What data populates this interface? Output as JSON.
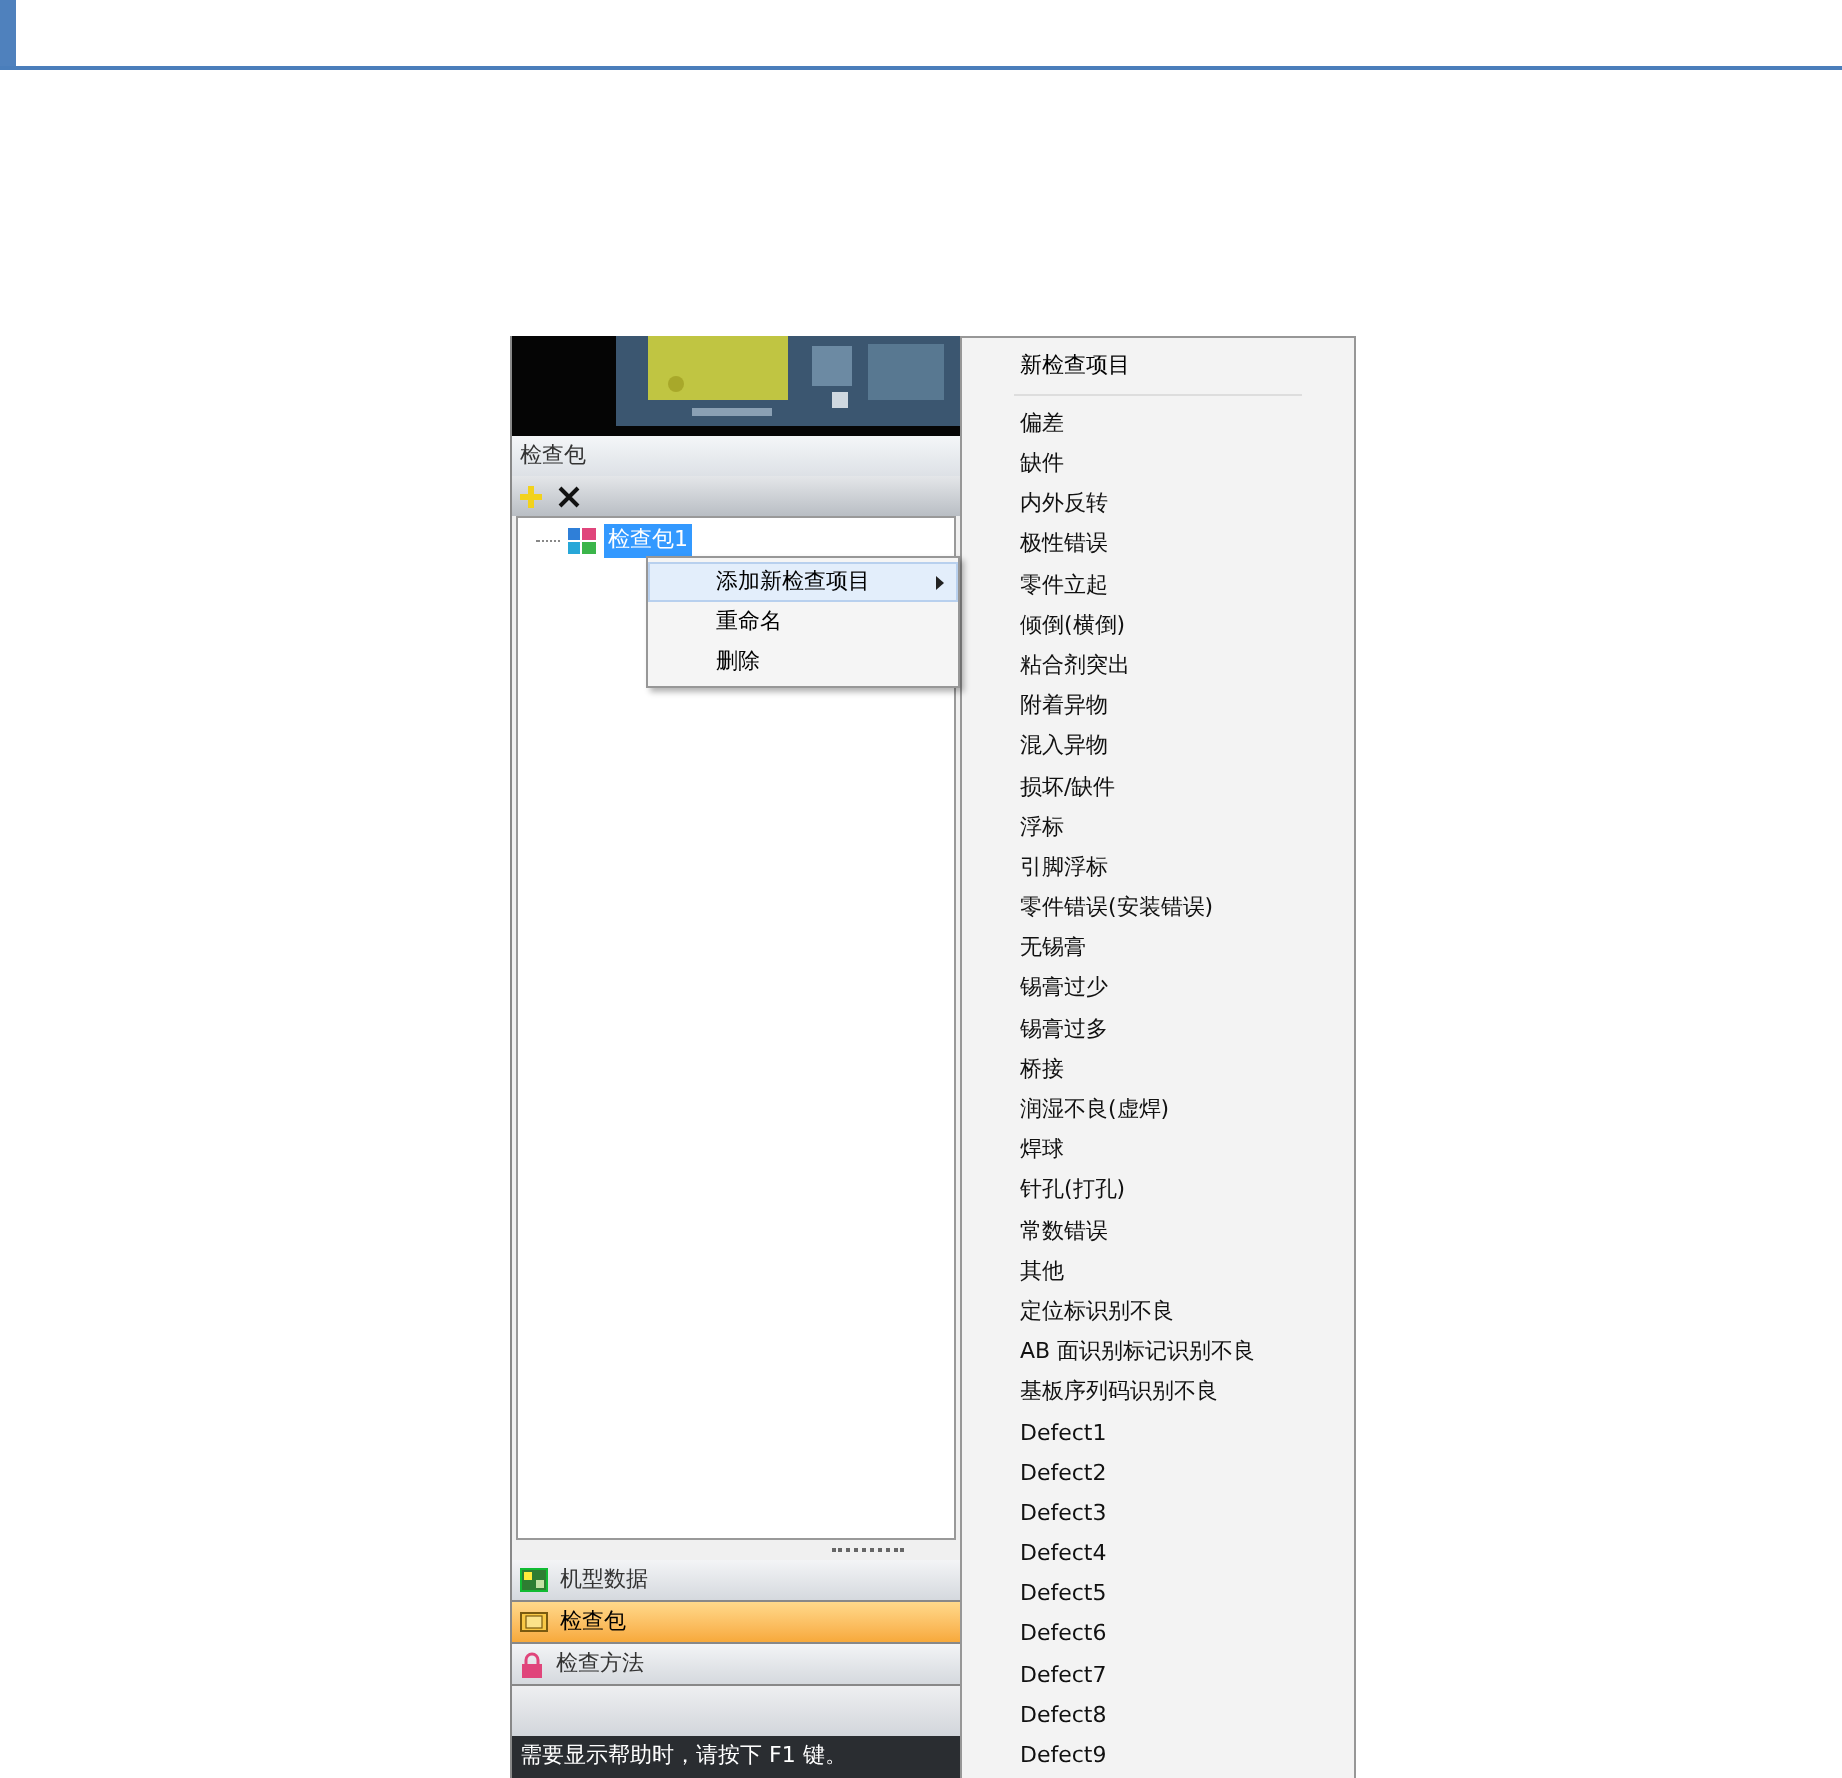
{
  "panel": {
    "title": "检查包"
  },
  "tree": [
    {
      "label": "检查包1",
      "selected": true
    }
  ],
  "context_menu": [
    {
      "label": "添加新检查项目",
      "has_submenu": true,
      "selected": true
    },
    {
      "label": "重命名",
      "has_submenu": false,
      "selected": false
    },
    {
      "label": "删除",
      "has_submenu": false,
      "selected": false
    }
  ],
  "submenu": {
    "header": "新检查项目",
    "items": [
      "偏差",
      "缺件",
      "内外反转",
      "极性错误",
      "零件立起",
      "倾倒(横倒)",
      "粘合剂突出",
      "附着异物",
      "混入异物",
      "损坏/缺件",
      "浮标",
      "引脚浮标",
      "零件错误(安装错误)",
      "无锡膏",
      "锡膏过少",
      "锡膏过多",
      "桥接",
      "润湿不良(虚焊)",
      "焊球",
      "针孔(打孔)",
      "常数错误",
      "其他",
      "定位标识别不良",
      "AB 面识别标记识别不良",
      "基板序列码识别不良",
      "Defect1",
      "Defect2",
      "Defect3",
      "Defect4",
      "Defect5",
      "Defect6",
      "Defect7",
      "Defect8",
      "Defect9"
    ]
  },
  "nav": [
    {
      "label": "机型数据",
      "kind": "board",
      "selected": false
    },
    {
      "label": "检查包",
      "kind": "package",
      "selected": true
    },
    {
      "label": "检查方法",
      "kind": "lock",
      "selected": false
    }
  ],
  "status_bar": "需要显示帮助时，请按下 F1 键。"
}
